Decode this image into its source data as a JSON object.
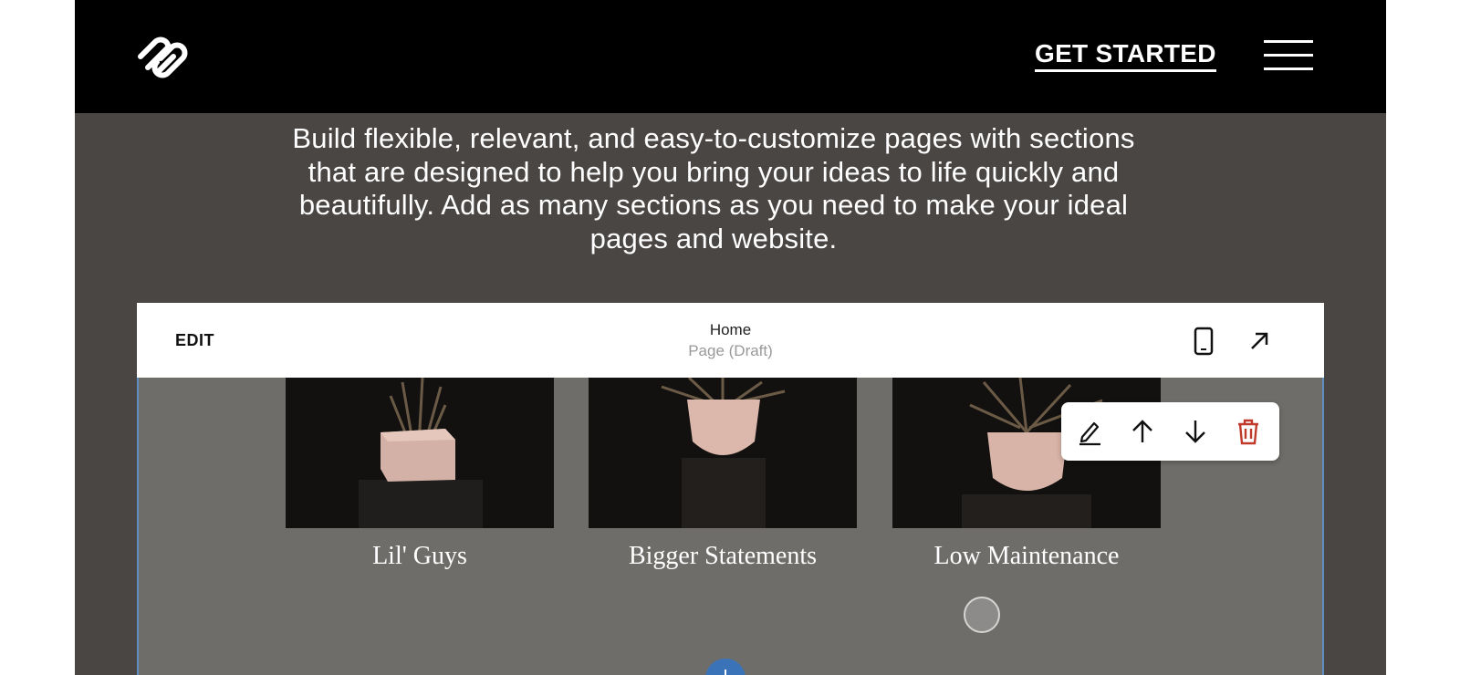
{
  "site": {
    "get_started_label": "GET STARTED",
    "intro_text": "Build flexible, relevant, and easy-to-customize pages with sections that are designed to help you bring your ideas to life quickly and beautifully. Add as many sections as you need to make your ideal pages and website."
  },
  "editor": {
    "edit_label": "EDIT",
    "page_title": "Home",
    "page_status": "Page (Draft)"
  },
  "products": [
    {
      "label": "Lil' Guys"
    },
    {
      "label": "Bigger Statements"
    },
    {
      "label": "Low Maintenance"
    }
  ],
  "toolbar_icons": [
    "pencil-icon",
    "arrow-up-icon",
    "arrow-down-icon",
    "trash-icon"
  ],
  "colors": {
    "header_bg": "#000000",
    "frame_bg": "#4a4644",
    "canvas_bg": "#6e6d6a",
    "selection_border": "#5e8fc0",
    "delete_red": "#c0392b",
    "add_button": "#3b73b9"
  }
}
